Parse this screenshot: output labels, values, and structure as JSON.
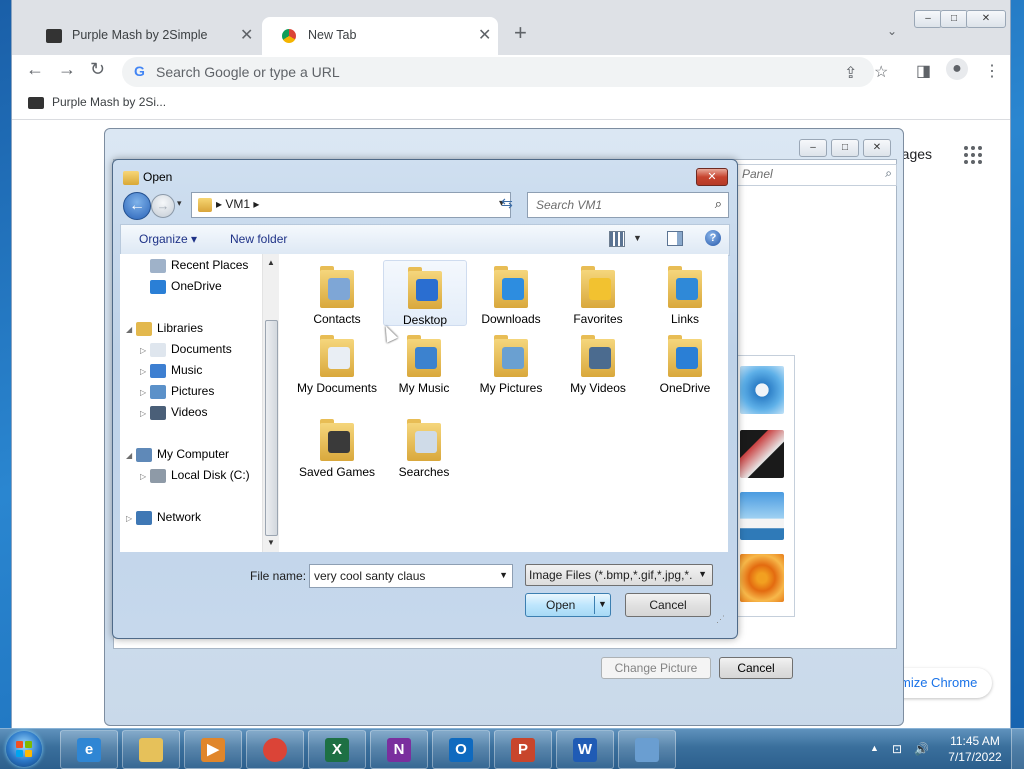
{
  "chrome": {
    "tabs": [
      {
        "title": "Purple Mash by 2Simple",
        "active": false
      },
      {
        "title": "New Tab",
        "active": true
      }
    ],
    "new_tab_symbol": "+",
    "close_symbol": "✕",
    "omnibox_placeholder": "Search Google or type a URL",
    "bookmark": "Purple Mash by 2Si...",
    "images_link": "mages",
    "customize_label": "mize Chrome",
    "window_buttons": [
      "–",
      "□",
      "✕"
    ]
  },
  "outer_dialog": {
    "search_placeholder": "Panel",
    "change_picture_label": "Change Picture",
    "cancel_label": "Cancel"
  },
  "open_dialog": {
    "title": "Open",
    "breadcrumb": "▸ VM1 ▸",
    "search_placeholder": "Search VM1",
    "commands": {
      "organize": "Organize ▾",
      "new_folder": "New folder"
    },
    "nav_tree": [
      {
        "label": "Recent Places",
        "level": 1,
        "icon": "recent-places-icon",
        "color": "#9fb2c9"
      },
      {
        "label": "OneDrive",
        "level": 1,
        "icon": "onedrive-icon",
        "color": "#2a7fd6"
      },
      {
        "label": "Libraries",
        "level": 0,
        "icon": "libraries-icon",
        "color": "#e3b84d"
      },
      {
        "label": "Documents",
        "level": 1,
        "icon": "documents-icon",
        "color": "#dfe6ee"
      },
      {
        "label": "Music",
        "level": 1,
        "icon": "music-icon",
        "color": "#3d7fd1"
      },
      {
        "label": "Pictures",
        "level": 1,
        "icon": "pictures-icon",
        "color": "#5b91c9"
      },
      {
        "label": "Videos",
        "level": 1,
        "icon": "videos-icon",
        "color": "#4a5f78"
      },
      {
        "label": "My Computer",
        "level": 0,
        "icon": "computer-icon",
        "color": "#5f89b8"
      },
      {
        "label": "Local Disk (C:)",
        "level": 1,
        "icon": "disk-icon",
        "color": "#8e9aa7"
      },
      {
        "label": "Network",
        "level": 0,
        "icon": "network-icon",
        "color": "#3f78b5"
      }
    ],
    "items": [
      {
        "label": "Contacts",
        "overlay": "#7ea6d6"
      },
      {
        "label": "Desktop",
        "overlay": "#2a6ed1",
        "selected": true
      },
      {
        "label": "Downloads",
        "overlay": "#2d8de0"
      },
      {
        "label": "Favorites",
        "overlay": "#f2c230"
      },
      {
        "label": "Links",
        "overlay": "#2f89d8"
      },
      {
        "label": "My Documents",
        "overlay": "#e9eef4"
      },
      {
        "label": "My Music",
        "overlay": "#3c82cf"
      },
      {
        "label": "My Pictures",
        "overlay": "#6aa0d1"
      },
      {
        "label": "My Videos",
        "overlay": "#4b6b8f"
      },
      {
        "label": "OneDrive",
        "overlay": "#2a7fd6"
      },
      {
        "label": "Saved Games",
        "overlay": "#3a3a3a"
      },
      {
        "label": "Searches",
        "overlay": "#cfdbe8"
      }
    ],
    "file_name_label": "File name:",
    "file_name_value": "very cool santy claus",
    "filter_value": "Image Files (*.bmp,*.gif,*.jpg,*.",
    "open_label": "Open",
    "cancel_label": "Cancel"
  },
  "taskbar": {
    "apps": [
      {
        "name": "internet-explorer",
        "letter": "e",
        "color": "#2f86d4"
      },
      {
        "name": "file-explorer",
        "letter": "",
        "color": "#e6c15a"
      },
      {
        "name": "media-player",
        "letter": "▶",
        "color": "#e0862b"
      },
      {
        "name": "chrome",
        "letter": "",
        "color": "#db4437"
      },
      {
        "name": "excel",
        "letter": "X",
        "color": "#1d7044"
      },
      {
        "name": "onenote",
        "letter": "N",
        "color": "#7a2f9e"
      },
      {
        "name": "outlook",
        "letter": "O",
        "color": "#0f6abf"
      },
      {
        "name": "powerpoint",
        "letter": "P",
        "color": "#c8452c"
      },
      {
        "name": "word",
        "letter": "W",
        "color": "#1f5bb5"
      },
      {
        "name": "control-panel",
        "letter": "",
        "color": "#6a9ed1"
      }
    ],
    "time": "11:45 AM",
    "date": "7/17/2022"
  }
}
